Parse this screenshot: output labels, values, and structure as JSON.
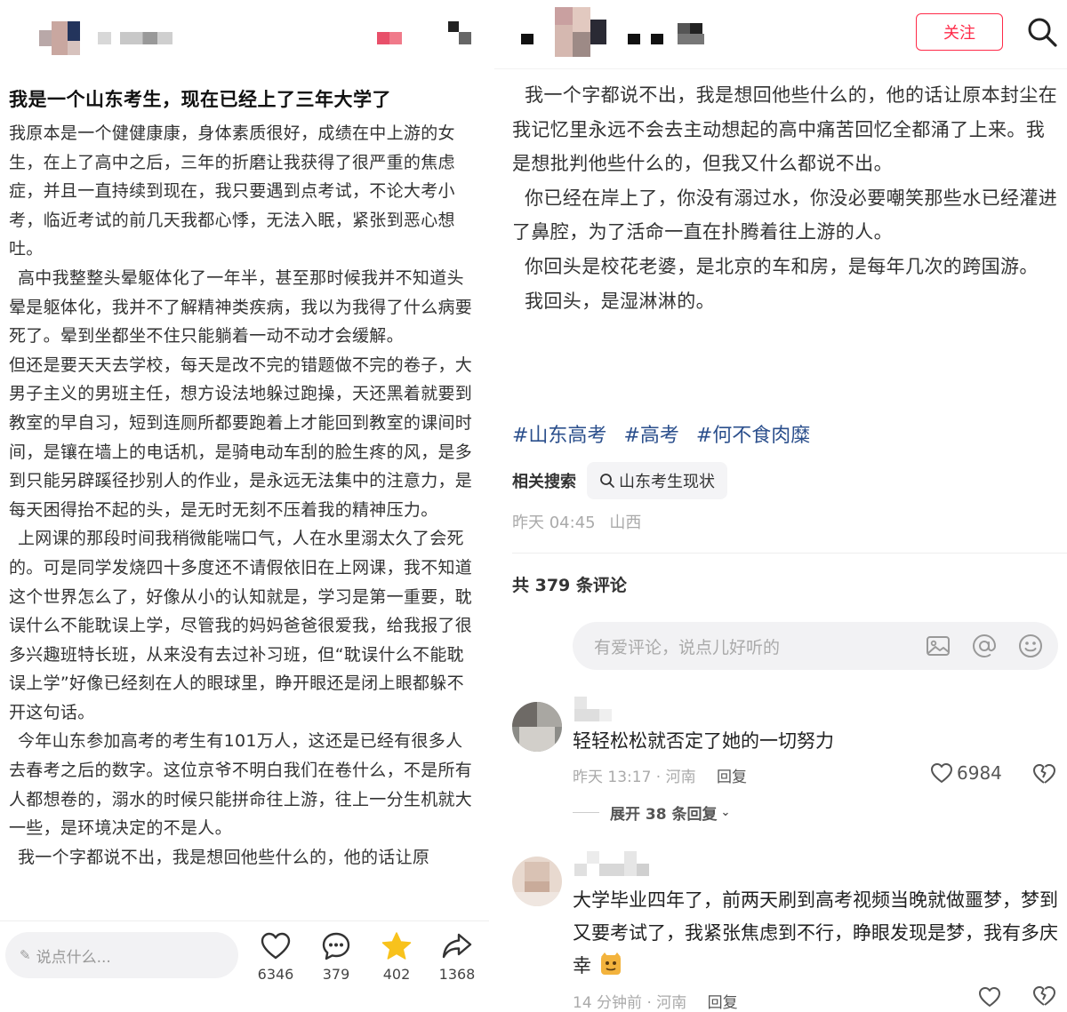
{
  "left": {
    "title": "我是一个山东考生，现在已经上了三年大学了",
    "paragraphs": [
      "我原本是一个健健康康，身体素质很好，成绩在中上游的女生，在上了高中之后，三年的折磨让我获得了很严重的焦虑症，并且一直持续到现在，我只要遇到点考试，不论大考小考，临近考试的前几天我都心悸，无法入眠，紧张到恶心想吐。",
      "高中我整整头晕躯体化了一年半，甚至那时候我并不知道头晕是躯体化，我并不了解精神类疾病，我以为我得了什么病要死了。晕到坐都坐不住只能躺着一动不动才会缓解。",
      "但还是要天天去学校，每天是改不完的错题做不完的卷子，大男子主义的男班主任，想方设法地躲过跑操，天还黑着就要到教室的早自习，短到连厕所都要跑着上才能回到教室的课间时间，是镶在墙上的电话机，是骑电动车刮的脸生疼的风，是多到只能另辟蹊径抄别人的作业，是永远无法集中的注意力，是每天困得抬不起的头，是无时无刻不压着我的精神压力。",
      "上网课的那段时间我稍微能喘口气，人在水里溺太久了会死的。可是同学发烧四十多度还不请假依旧在上网课，我不知道这个世界怎么了，好像从小的认知就是，学习是第一重要，耽误什么不能耽误上学，尽管我的妈妈爸爸很爱我，给我报了很多兴趣班特长班，从来没有去过补习班，但“耽误什么不能耽误上学”好像已经刻在人的眼球里，睁开眼还是闭上眼都躲不开这句话。",
      "今年山东参加高考的考生有101万人，这还是已经有很多人去春考之后的数字。这位京爷不明白我们在卷什么，不是所有人都想卷的，溺水的时候只能拼命往上游，往上一分生机就大一些，是环境决定的不是人。",
      "我一个字都说不出，我是想回他些什么的，他的话让原"
    ],
    "bottom": {
      "comment_placeholder": "说点什么...",
      "likes": "6346",
      "comments": "379",
      "stars": "402",
      "shares": "1368"
    }
  },
  "right": {
    "follow_label": "关注",
    "paragraphs": [
      "我一个字都说不出，我是想回他些什么的，他的话让原本封尘在我记忆里永远不会去主动想起的高中痛苦回忆全都涌了上来。我是想批判他些什么的，但我又什么都说不出。",
      "你已经在岸上了，你没有溺过水，你没必要嘲笑那些水已经灌进了鼻腔，为了活命一直在扑腾着往上游的人。",
      "你回头是校花老婆，是北京的车和房，是每年几次的跨国游。",
      "我回头，是湿淋淋的。"
    ],
    "tags": [
      "#山东高考",
      "#高考",
      "#何不食肉糜"
    ],
    "related_label": "相关搜索",
    "related_query": "山东考生现状",
    "time": "昨天 04:45",
    "location": "山西",
    "comment_count": "共 379 条评论",
    "comment_placeholder": "有爱评论，说点儿好听的",
    "comments": [
      {
        "text": "轻轻松松就否定了她的一切努力",
        "meta": "昨天 13:17 · 河南",
        "reply": "回复",
        "likes": "6984",
        "expand": "展开 38 条回复"
      },
      {
        "text": "大学毕业四年了，前两天刷到高考视频当晚就做噩梦，梦到又要考试了，我紧张焦虑到不行，睁眼发现是梦，我有多庆幸",
        "meta": "14 分钟前 · 河南",
        "reply": "回复"
      }
    ]
  },
  "colors": {
    "accent_red": "#ff2a48",
    "tag_blue": "#2b4f8c",
    "star_yellow": "#f8c21c"
  }
}
